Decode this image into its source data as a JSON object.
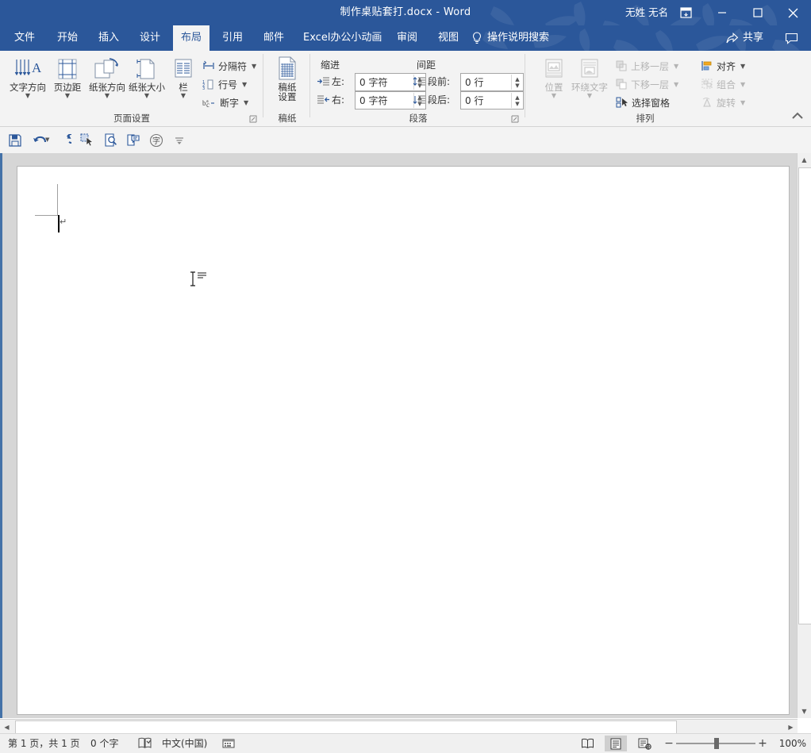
{
  "titlebar": {
    "document_title": "制作桌贴套打.docx  -  Word",
    "user_name": "无姓 无名",
    "ribbon_display_options": "ribbon-display-options",
    "minimize": "最小化",
    "maximize": "最大化",
    "close": "关闭",
    "bg_color": "#2b579a"
  },
  "tabs": [
    {
      "label": "文件",
      "active": false
    },
    {
      "label": "开始",
      "active": false
    },
    {
      "label": "插入",
      "active": false
    },
    {
      "label": "设计",
      "active": false
    },
    {
      "label": "布局",
      "active": true
    },
    {
      "label": "引用",
      "active": false
    },
    {
      "label": "邮件",
      "active": false
    },
    {
      "label": "Excel办公小动画",
      "active": false
    },
    {
      "label": "审阅",
      "active": false
    },
    {
      "label": "视图",
      "active": false
    }
  ],
  "tellme": {
    "label": "操作说明搜索"
  },
  "share": {
    "label": "共享"
  },
  "ribbon": {
    "groups": [
      {
        "name": "页面设置",
        "big_buttons": [
          {
            "label": "文字方向",
            "icon": "text-direction-icon"
          },
          {
            "label": "页边距",
            "icon": "margins-icon"
          },
          {
            "label": "纸张方向",
            "icon": "orientation-icon"
          },
          {
            "label": "纸张大小",
            "icon": "size-icon"
          },
          {
            "label": "栏",
            "icon": "columns-icon"
          }
        ],
        "small_buttons": [
          {
            "label": "分隔符",
            "icon": "breaks-icon",
            "disabled": false
          },
          {
            "label": "行号",
            "icon": "line-numbers-icon",
            "disabled": false
          },
          {
            "label": "断字",
            "icon": "hyphenation-icon",
            "disabled": false
          }
        ]
      },
      {
        "name": "稿纸",
        "big_buttons": [
          {
            "label": "稿纸\n设置",
            "label_line1": "稿纸",
            "label_line2": "设置",
            "icon": "grid-paper-icon"
          }
        ]
      },
      {
        "name": "段落",
        "headers": {
          "indent": "缩进",
          "spacing": "间距"
        },
        "fields": [
          {
            "label": "左:",
            "value": "0 字符",
            "icon": "indent-left-icon"
          },
          {
            "label": "右:",
            "value": "0 字符",
            "icon": "indent-right-icon"
          },
          {
            "label": "段前:",
            "value": "0 行",
            "icon": "space-before-icon"
          },
          {
            "label": "段后:",
            "value": "0 行",
            "icon": "space-after-icon"
          }
        ]
      },
      {
        "name": "排列",
        "big_buttons": [
          {
            "label": "位置",
            "icon": "position-icon",
            "disabled": true
          },
          {
            "label": "环绕文字",
            "icon": "wrap-text-icon",
            "disabled": true
          }
        ],
        "small_buttons": [
          {
            "label": "上移一层",
            "icon": "bring-forward-icon",
            "disabled": true
          },
          {
            "label": "下移一层",
            "icon": "send-backward-icon",
            "disabled": true
          },
          {
            "label": "选择窗格",
            "icon": "selection-pane-icon",
            "disabled": false
          },
          {
            "label": "对齐",
            "icon": "align-icon",
            "disabled": false
          },
          {
            "label": "组合",
            "icon": "group-icon",
            "disabled": true
          },
          {
            "label": "旋转",
            "icon": "rotate-icon",
            "disabled": true
          }
        ]
      }
    ],
    "collapse_label": "折叠功能区"
  },
  "quick_toolbar": {
    "buttons": [
      {
        "name": "save-icon",
        "title": "保存"
      },
      {
        "name": "undo-icon",
        "title": "撤消"
      },
      {
        "name": "redo-icon",
        "title": "恢复"
      },
      {
        "name": "select-object-icon",
        "title": "选择对象"
      },
      {
        "name": "print-preview-icon",
        "title": "打印预览"
      },
      {
        "name": "insert-comment-icon",
        "title": "插入批注"
      },
      {
        "name": "phonetic-guide-icon",
        "title": "拼音指南"
      },
      {
        "name": "more-commands-icon",
        "title": "其他命令"
      }
    ]
  },
  "statusbar": {
    "page_info": "第 1 页，共 1 页",
    "word_count": "0 个字",
    "proofing_icon": "proofing-errors-icon",
    "language": "中文(中国)",
    "macro_icon": "record-macro-icon",
    "views": [
      {
        "name": "read-mode-view",
        "label": "阅读视图",
        "active": false
      },
      {
        "name": "print-layout-view",
        "label": "页面视图",
        "active": true
      },
      {
        "name": "web-layout-view",
        "label": "Web 版式视图",
        "active": false
      }
    ],
    "zoom_out": "−",
    "zoom_in": "+",
    "zoom_level": "100%"
  },
  "document": {
    "page_background": "#ffffff",
    "canvas_background": "#d6d6d6",
    "paragraph_mark": "↵",
    "caret_visible": true
  }
}
